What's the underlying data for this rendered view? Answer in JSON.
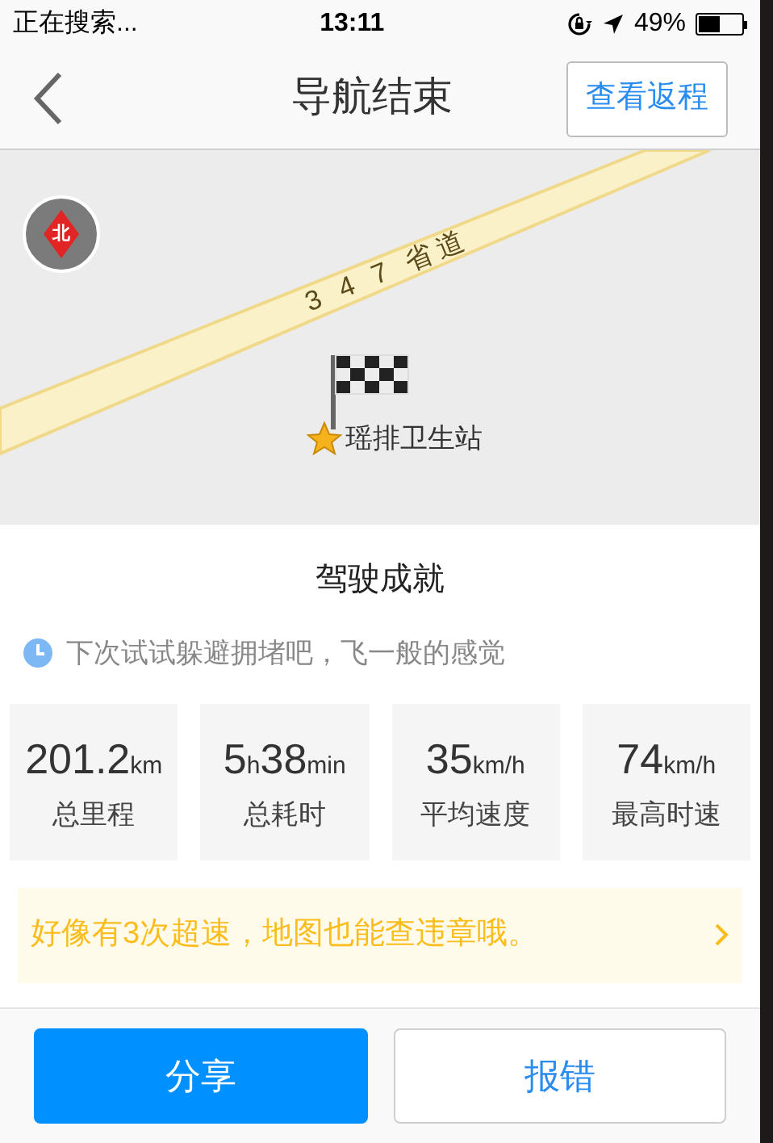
{
  "status_bar": {
    "carrier": "正在搜索...",
    "time": "13:11",
    "battery": "49%"
  },
  "nav": {
    "title": "导航结束",
    "action": "查看返程"
  },
  "map": {
    "compass": "北",
    "road": "3 4 7 省道",
    "destination": "瑶排卫生站"
  },
  "summary": {
    "title": "驾驶成就",
    "tip": "下次试试躲避拥堵吧，飞一般的感觉",
    "stats": [
      {
        "value": "201.2",
        "unit": "km",
        "label": "总里程"
      },
      {
        "value": "5",
        "unit": "h",
        "value_2": "38",
        "unit_2": "min",
        "label": "总耗时"
      },
      {
        "value": "35",
        "unit": "km/h",
        "label": "平均速度"
      },
      {
        "value": "74",
        "unit": "km/h",
        "label": "最高时速"
      }
    ],
    "notice": "好像有3次超速，地图也能查违章哦。"
  },
  "buttons": [
    {
      "label": "分享",
      "kind": "primary"
    },
    {
      "label": "报错",
      "kind": "outline"
    }
  ]
}
